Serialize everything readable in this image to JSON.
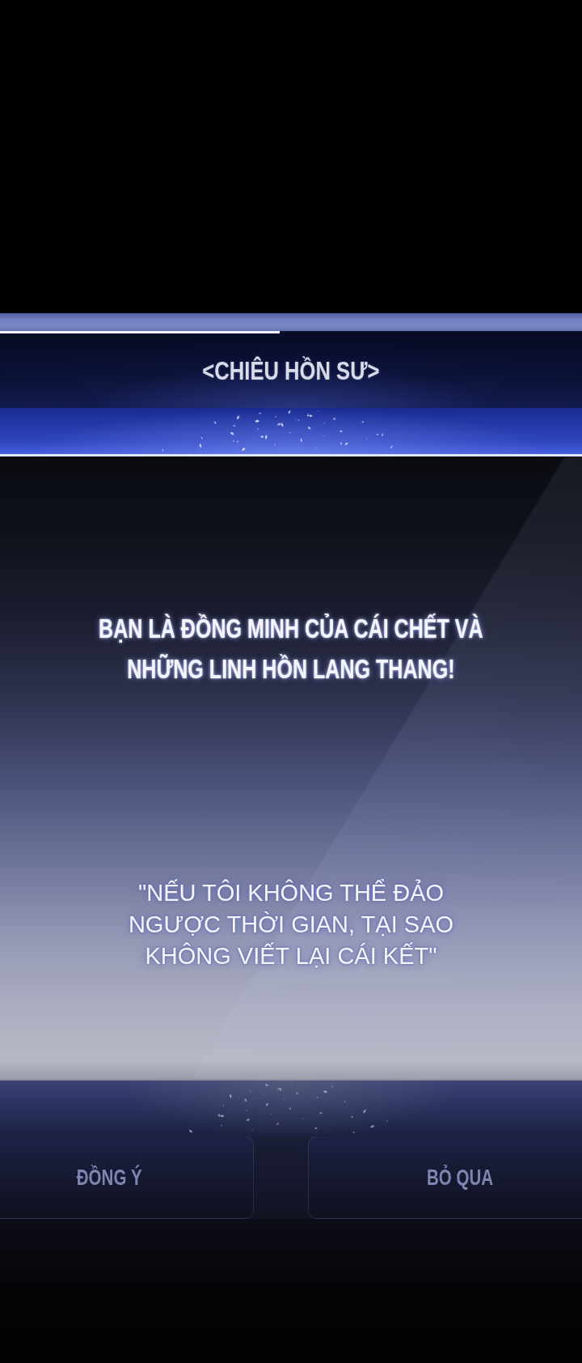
{
  "header": {
    "progress": {
      "level": 0.48
    },
    "title": "<CHIÊU HỒN SƯ>"
  },
  "dialog": {
    "message": "BẠN LÀ ĐỒNG MINH CỦA CÁI CHẾT VÀ\nNHỮNG LINH HỒN LANG THANG!",
    "quote": "\"NẾU TÔI KHÔNG THỂ ĐẢO\nNGƯỢC THỜI GIAN, TẠI SAO\nKHÔNG VIẾT LẠI CÁI KẾT\""
  },
  "buttons": [
    "ĐỒNG Ý",
    "BỎ QUA"
  ]
}
